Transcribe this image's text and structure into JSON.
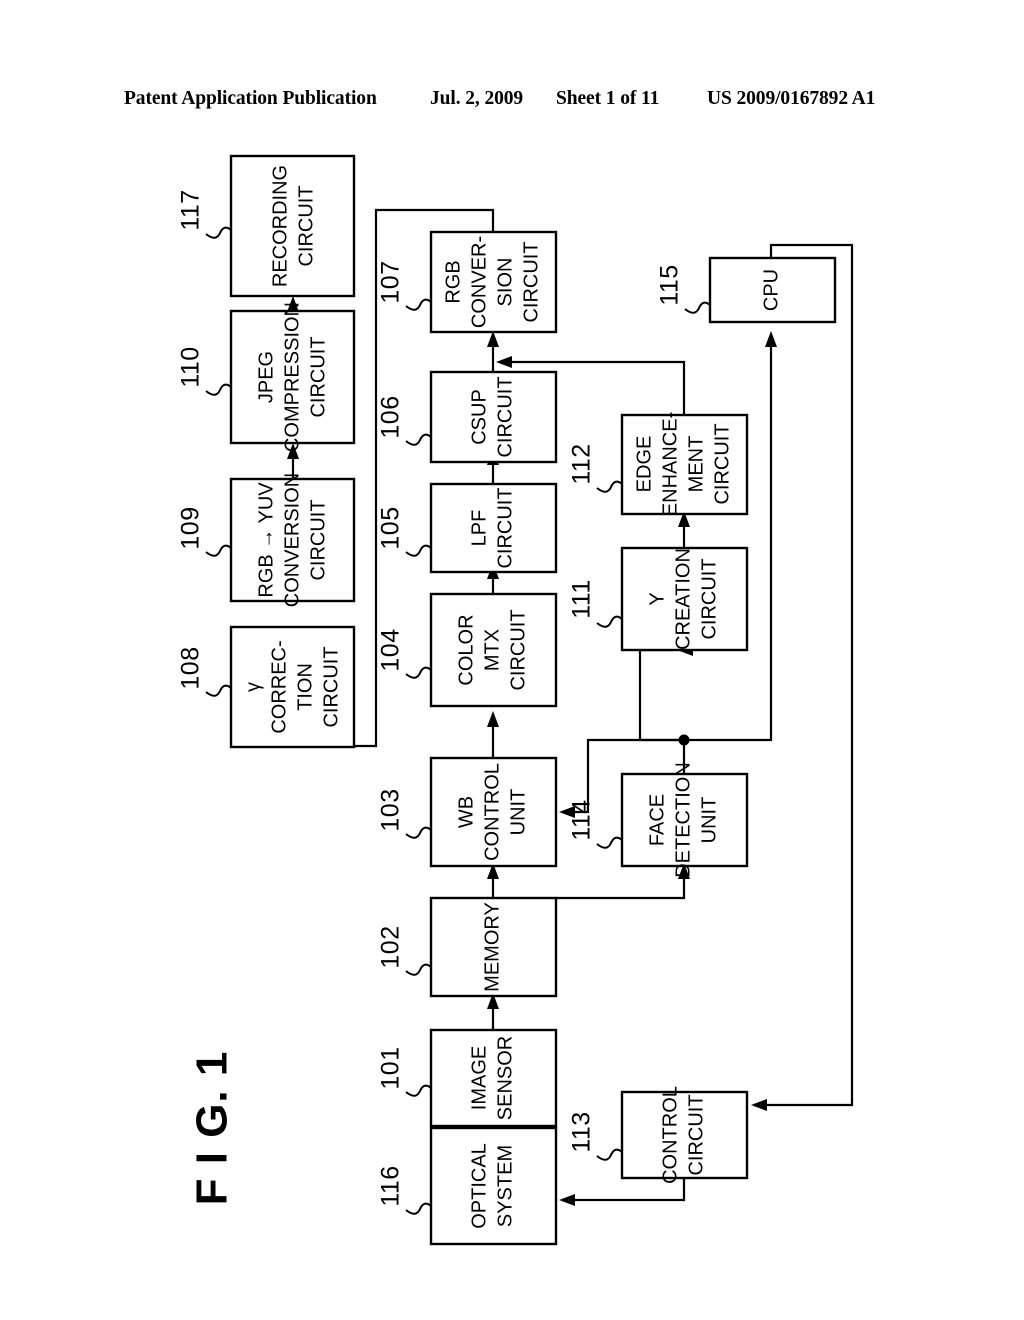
{
  "header": {
    "publication": "Patent Application Publication",
    "date": "Jul. 2, 2009",
    "sheet": "Sheet 1 of 11",
    "number": "US 2009/0167892 A1"
  },
  "figure": {
    "label": "F I G.  1",
    "orientation_deg": -90
  },
  "blocks": [
    {
      "id": "117",
      "ref": "117",
      "lines": [
        "RECORDING",
        "CIRCUIT"
      ]
    },
    {
      "id": "110",
      "ref": "110",
      "lines": [
        "JPEG",
        "COMPRESSION",
        "CIRCUIT"
      ]
    },
    {
      "id": "109",
      "ref": "109",
      "lines": [
        "RGB → YUV",
        "CONVERSION",
        "CIRCUIT"
      ]
    },
    {
      "id": "108",
      "ref": "108",
      "lines": [
        "γ",
        "CORREC-",
        "TION",
        "CIRCUIT"
      ]
    },
    {
      "id": "107",
      "ref": "107",
      "lines": [
        "RGB",
        "CONVER-",
        "SION",
        "CIRCUIT"
      ]
    },
    {
      "id": "106",
      "ref": "106",
      "lines": [
        "CSUP",
        "CIRCUIT"
      ]
    },
    {
      "id": "105",
      "ref": "105",
      "lines": [
        "LPF",
        "CIRCUIT"
      ]
    },
    {
      "id": "104",
      "ref": "104",
      "lines": [
        "COLOR",
        "MTX",
        "CIRCUIT"
      ]
    },
    {
      "id": "103",
      "ref": "103",
      "lines": [
        "WB",
        "CONTROL",
        "UNIT"
      ]
    },
    {
      "id": "102",
      "ref": "102",
      "lines": [
        "MEMORY"
      ]
    },
    {
      "id": "101",
      "ref": "101",
      "lines": [
        "IMAGE",
        "SENSOR"
      ]
    },
    {
      "id": "116",
      "ref": "116",
      "lines": [
        "OPTICAL",
        "SYSTEM"
      ]
    },
    {
      "id": "115",
      "ref": "115",
      "lines": [
        "CPU"
      ]
    },
    {
      "id": "114",
      "ref": "114",
      "lines": [
        "FACE",
        "DETECTION",
        "UNIT"
      ]
    },
    {
      "id": "113",
      "ref": "113",
      "lines": [
        "CONTROL",
        "CIRCUIT"
      ]
    },
    {
      "id": "112",
      "ref": "112",
      "lines": [
        "EDGE",
        "ENHANCE-",
        "MENT",
        "CIRCUIT"
      ]
    },
    {
      "id": "111",
      "ref": "111",
      "lines": [
        "Y",
        "CREATION",
        "CIRCUIT"
      ]
    }
  ],
  "reference_numerals": [
    "101",
    "102",
    "103",
    "104",
    "105",
    "106",
    "107",
    "108",
    "109",
    "110",
    "111",
    "112",
    "113",
    "114",
    "115",
    "116",
    "117"
  ],
  "colors": {
    "ink": "#000000",
    "paper": "#ffffff"
  }
}
